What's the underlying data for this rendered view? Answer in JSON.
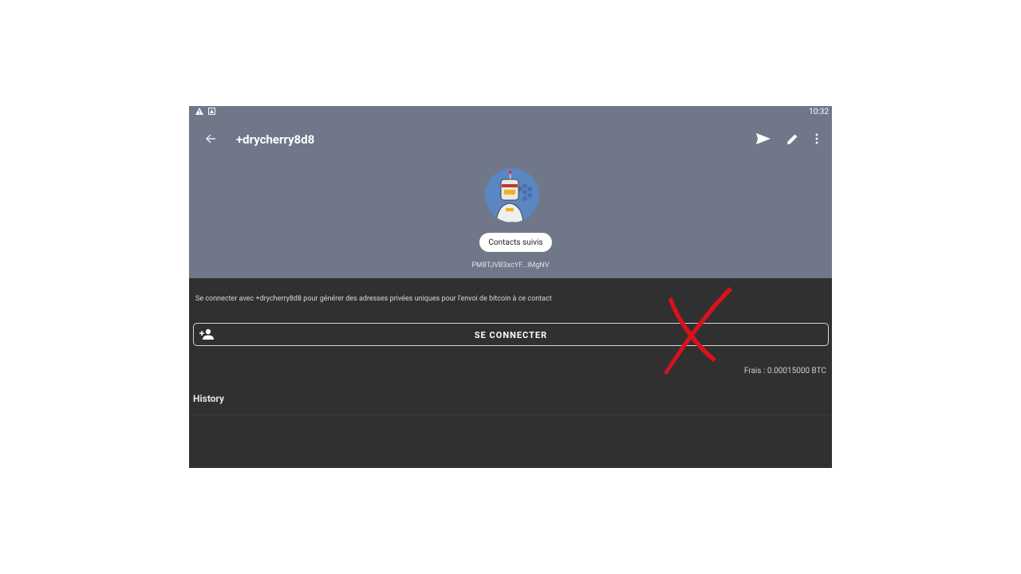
{
  "status_bar": {
    "time": "10:32",
    "icons": [
      "warning-icon",
      "notification-icon"
    ]
  },
  "toolbar": {
    "back_icon": "arrow-back-icon",
    "title": "+drycherry8d8",
    "actions": [
      "send-icon",
      "edit-pencil-icon",
      "more-vert-icon"
    ]
  },
  "profile": {
    "avatar": "robot-avatar",
    "chip_label": "Contacts suivis",
    "paynym_code": "PM8TJVB3xcYF...iMgNV"
  },
  "connect_section": {
    "description": "Se connecter avec +drycherry8d8 pour générer des adresses privées uniques pour l'envoi de bitcoin à ce contact",
    "button_label": "SE CONNECTER",
    "button_icon": "person-add-icon",
    "fees": "Frais : 0.00015000 BTC"
  },
  "history": {
    "title": "History"
  },
  "overlay": {
    "mark": "red-x-mark",
    "color": "#d8121b"
  },
  "colors": {
    "header_bg": "#6f7789",
    "body_bg": "#303030"
  }
}
